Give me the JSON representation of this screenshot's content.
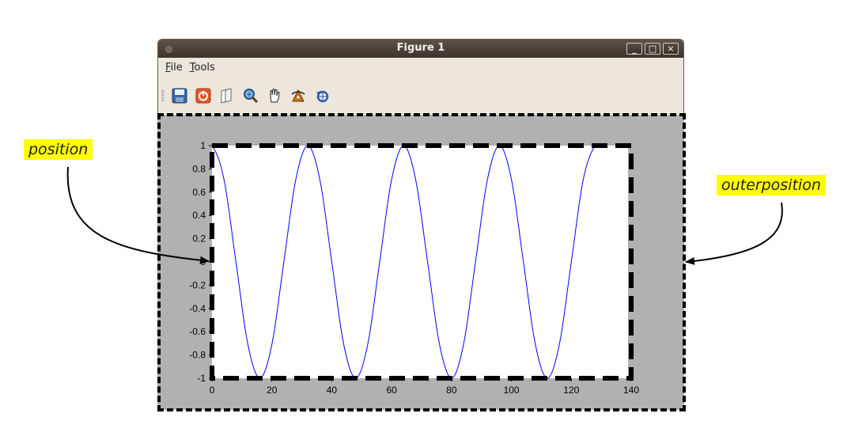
{
  "window": {
    "title": "Figure 1",
    "controls": {
      "minimize": "_",
      "maximize": "□",
      "close": "×"
    }
  },
  "menu": {
    "file": {
      "mnemonic": "F",
      "rest": "ile"
    },
    "tools": {
      "mnemonic": "T",
      "rest": "ools"
    }
  },
  "toolbar": {
    "icons": [
      "save-icon",
      "power-icon",
      "copy-icon",
      "zoom-icon",
      "pan-hand-icon",
      "rotate-3d-icon",
      "reset-view-icon"
    ]
  },
  "annotations": {
    "position": "position",
    "outerposition": "outerposition"
  },
  "colors": {
    "figure_bg": "#b1b1b1",
    "line": "#0000ff",
    "highlight": "#ffff00"
  },
  "chart_data": {
    "type": "line",
    "title": "",
    "xlabel": "",
    "ylabel": "",
    "xlim": [
      0,
      140
    ],
    "ylim": [
      -1,
      1
    ],
    "xticks": [
      0,
      20,
      40,
      60,
      80,
      100,
      120,
      140
    ],
    "yticks": [
      1,
      0.8,
      0.6,
      0.4,
      0.2,
      0,
      -0.2,
      -0.4,
      -0.6,
      -0.8,
      -1
    ],
    "ytick_labels": [
      "1",
      "0.8",
      "0.6",
      "0.4",
      "0.2",
      "0",
      "-0.2",
      "-0.4",
      "-0.6",
      "-0.8",
      "-1"
    ],
    "xtick_labels": [
      "0",
      "20",
      "40",
      "60",
      "80",
      "100",
      "120",
      "140"
    ],
    "grid": false,
    "series": [
      {
        "x": [
          0,
          4,
          8,
          12,
          16,
          20,
          24,
          28,
          32,
          36,
          40,
          44,
          48,
          52,
          56,
          60,
          64,
          68,
          72,
          76,
          80,
          84,
          88,
          92,
          96,
          100,
          104,
          108,
          112,
          116,
          120,
          124,
          128
        ],
        "y": [
          1,
          0.71,
          0,
          -0.71,
          -1,
          -0.71,
          0,
          0.71,
          1,
          0.71,
          0,
          -0.71,
          -1,
          -0.71,
          0,
          0.71,
          1,
          0.71,
          0,
          -0.71,
          -1,
          -0.71,
          0,
          0.71,
          1,
          0.71,
          0,
          -0.71,
          -1,
          -0.71,
          0,
          0.71,
          1
        ]
      }
    ]
  }
}
